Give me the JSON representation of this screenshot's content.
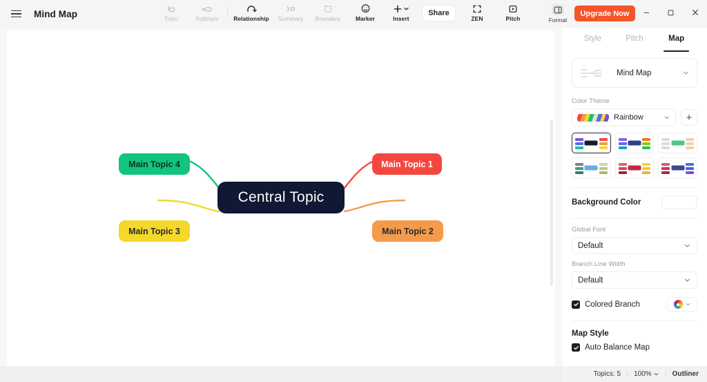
{
  "window": {
    "title": "Mind Map",
    "menu_icon": "hamburger-icon",
    "controls": {
      "minimize": "minimize-icon",
      "maximize": "maximize-icon",
      "close": "close-icon"
    }
  },
  "toolbar": {
    "tools": [
      {
        "label": "Topic",
        "icon": "topic-icon",
        "enabled": false
      },
      {
        "label": "Subtopic",
        "icon": "subtopic-icon",
        "enabled": false
      },
      {
        "label": "Relationship",
        "icon": "relationship-icon",
        "enabled": true
      },
      {
        "label": "Summary",
        "icon": "summary-icon",
        "enabled": false
      },
      {
        "label": "Boundary",
        "icon": "boundary-icon",
        "enabled": false
      },
      {
        "label": "Marker",
        "icon": "marker-smiley-icon",
        "enabled": true
      },
      {
        "label": "Insert",
        "icon": "plus-icon",
        "enabled": true
      }
    ],
    "share_label": "Share",
    "zen_label": "ZEN",
    "pitch_label": "Pitch",
    "format_label": "Format",
    "upgrade_label": "Upgrade Now",
    "accent_color": "#f4552a"
  },
  "canvas": {
    "central": {
      "text": "Central Topic",
      "bg": "#111833",
      "fg": "#ffffff"
    },
    "branches": [
      {
        "text": "Main Topic 1",
        "bg": "#f4483f",
        "fg": "#ffffff",
        "line": "#f4483f"
      },
      {
        "text": "Main Topic 2",
        "bg": "#f59a4b",
        "fg": "#2a2a2c",
        "line": "#f59a4b"
      },
      {
        "text": "Main Topic 3",
        "bg": "#f4d82a",
        "fg": "#2a2a2c",
        "line": "#f4d82a"
      },
      {
        "text": "Main Topic 4",
        "bg": "#12c47c",
        "fg": "#103026",
        "line": "#12c47c"
      }
    ]
  },
  "panel": {
    "tabs": [
      {
        "label": "Style",
        "active": false
      },
      {
        "label": "Pitch",
        "active": false
      },
      {
        "label": "Map",
        "active": true
      }
    ],
    "map_type": {
      "label": "Mind Map",
      "icon": "mindmap-structure-icon",
      "chevron": "chevron-down-icon"
    },
    "color_theme": {
      "section_label": "Color Theme",
      "selected": "Rainbow",
      "add_label": "+",
      "swatches": [
        {
          "name": "theme-dark-rainbow",
          "selected": true,
          "center": "#161b2e",
          "left": [
            "#7b4ddb",
            "#4f6ef0",
            "#18c48b"
          ],
          "right": [
            "#f4483f",
            "#f59a4b",
            "#f4d82a"
          ]
        },
        {
          "name": "theme-navy-multi",
          "selected": false,
          "center": "#2f3f8f",
          "left": [
            "#8b5cf6",
            "#6366f1",
            "#0ea5a4"
          ],
          "right": [
            "#f97316",
            "#84cc16",
            "#22c55e"
          ]
        },
        {
          "name": "theme-green-light",
          "selected": false,
          "center": "#4ec78a",
          "left": [
            "#d8dce0",
            "#d8dce0",
            "#d8dce0"
          ],
          "right": [
            "#e8d6a8",
            "#e8d6a8",
            "#e8d6a8"
          ]
        },
        {
          "name": "theme-blue-grey",
          "selected": false,
          "center": "#6aa9e8",
          "left": [
            "#7a8287",
            "#3f9e85",
            "#2f7f6a"
          ],
          "right": [
            "#cfd6a0",
            "#b9c78a",
            "#a9bb7a"
          ]
        },
        {
          "name": "theme-crimson",
          "selected": false,
          "center": "#c4283f",
          "left": [
            "#e26070",
            "#d94458",
            "#a61f38"
          ],
          "right": [
            "#f4d82a",
            "#f0c83a",
            "#e8b43a"
          ]
        },
        {
          "name": "theme-purple-red",
          "selected": false,
          "center": "#3b4a8c",
          "left": [
            "#e05a6a",
            "#c43a55",
            "#a62a46"
          ],
          "right": [
            "#4f6ef0",
            "#5b5bd6",
            "#7b4ddb"
          ]
        }
      ]
    },
    "background_color": {
      "label": "Background Color",
      "value": "#ffffff"
    },
    "global_font": {
      "label": "Global Font",
      "value": "Default"
    },
    "branch_line_width": {
      "label": "Branch Line Width",
      "value": "Default"
    },
    "colored_branch": {
      "label": "Colored Branch",
      "checked": true,
      "swatch_icon": "color-wheel-icon"
    },
    "map_style": {
      "label": "Map Style"
    },
    "auto_balance": {
      "label": "Auto Balance Map",
      "checked": true
    }
  },
  "statusbar": {
    "topics_label": "Topics: 5",
    "zoom_label": "100%",
    "outliner_label": "Outliner"
  }
}
